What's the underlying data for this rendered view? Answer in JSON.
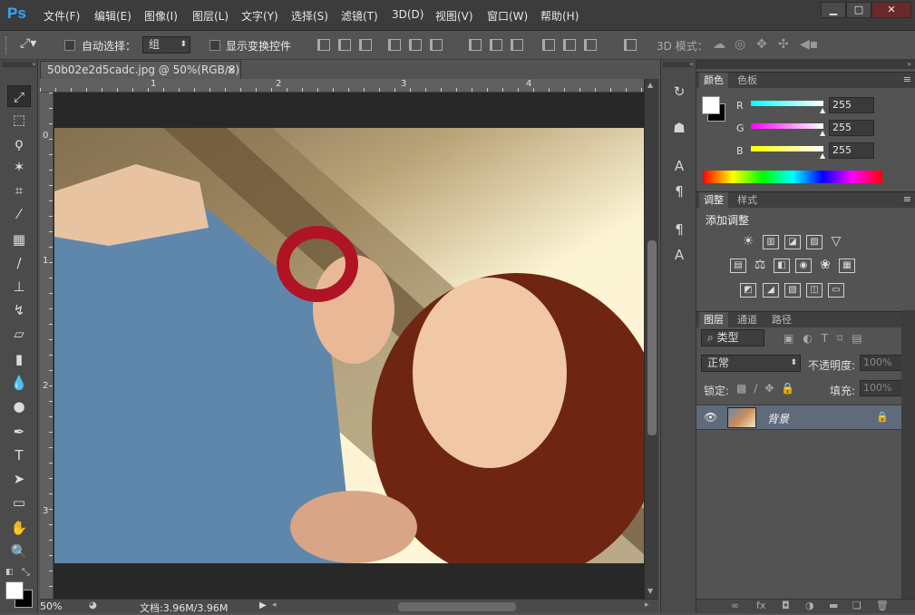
{
  "app": {
    "logo": "Ps",
    "menu": [
      "文件(F)",
      "编辑(E)",
      "图像(I)",
      "图层(L)",
      "文字(Y)",
      "选择(S)",
      "滤镜(T)",
      "3D(D)",
      "视图(V)",
      "窗口(W)",
      "帮助(H)"
    ],
    "window_buttons": [
      "▁",
      "□",
      "✕"
    ]
  },
  "options": {
    "auto_select_label": "自动选择：",
    "auto_select_value": "组",
    "show_transform_label": "显示变换控件",
    "mode_3d_label": "3D 模式："
  },
  "document": {
    "tab_title": "50b02e2d5cadc.jpg @ 50%(RGB/8)",
    "tab_close": "×",
    "ruler_h": [
      "1",
      "2",
      "3",
      "4"
    ],
    "ruler_v": [
      "0",
      "1",
      "2",
      "3",
      "4"
    ]
  },
  "status": {
    "zoom": "50%",
    "doc_info": "文档:3.96M/3.96M"
  },
  "color_panel": {
    "tabs": [
      "颜色",
      "色板"
    ],
    "channels": [
      {
        "label": "R",
        "value": "255",
        "color": "#27e6e6"
      },
      {
        "label": "G",
        "value": "255",
        "color": "#e03ce0"
      },
      {
        "label": "B",
        "value": "255",
        "color": "#e8e81c"
      }
    ]
  },
  "adjustments_panel": {
    "tabs": [
      "调整",
      "样式"
    ],
    "heading": "添加调整",
    "row1": [
      "☀",
      "▥",
      "◪",
      "▨",
      "▽"
    ],
    "row2": [
      "▤",
      "⚖",
      "◧",
      "◉",
      "❀",
      "▦"
    ],
    "row3": [
      "◩",
      "◢",
      "▧",
      "◫",
      "▭"
    ]
  },
  "layers_panel": {
    "tabs": [
      "图层",
      "通道",
      "路径"
    ],
    "filter_label": "类型",
    "blend_mode": "正常",
    "opacity_label": "不透明度:",
    "opacity_value": "100%",
    "lock_label": "锁定:",
    "fill_label": "填充:",
    "fill_value": "100%",
    "layer_name": "背景"
  },
  "colors": {
    "menubar": "#3c3c3c",
    "panel": "#535353",
    "selected_layer": "#5f6b7b",
    "accent": "#31a8ff"
  }
}
